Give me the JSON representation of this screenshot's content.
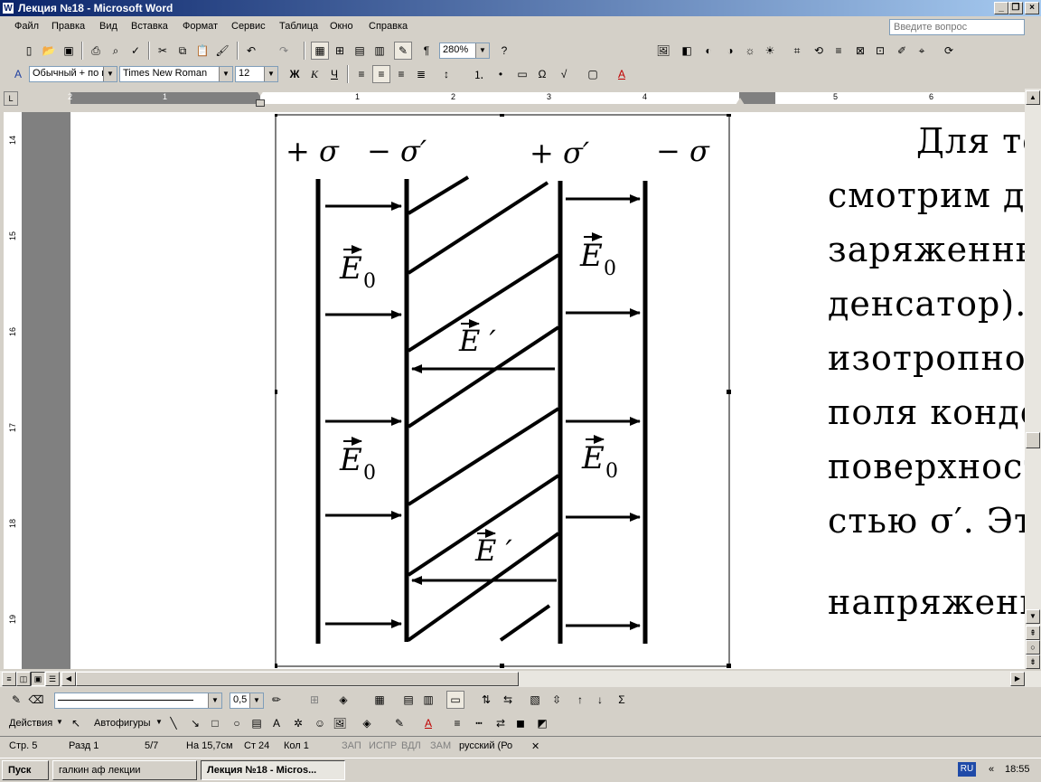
{
  "window": {
    "title": "Лекция №18 - Microsoft Word",
    "icon": "W"
  },
  "menu": {
    "items": [
      "Файл",
      "Правка",
      "Вид",
      "Вставка",
      "Формат",
      "Сервис",
      "Таблица",
      "Окно",
      "Справка"
    ],
    "help_placeholder": "Введите вопрос"
  },
  "standard_toolbar": {
    "zoom": "280%"
  },
  "format_toolbar": {
    "style": "Обычный + по ц",
    "font": "Times New Roman",
    "size": "12",
    "bold": "Ж",
    "italic": "К",
    "underline": "Ч"
  },
  "ruler": {
    "h_marks": [
      "2",
      "1",
      "1",
      "2",
      "3",
      "4",
      "5",
      "6",
      "7"
    ],
    "v_marks": [
      "14",
      "15",
      "16",
      "17",
      "18",
      "19"
    ]
  },
  "figure": {
    "labels": {
      "plus_sigma": "+ σ",
      "minus_sigma_prime": "− σ′",
      "plus_sigma_prime": "+ σ′",
      "minus_sigma": "− σ",
      "e0": "E",
      "e0_sub": "0",
      "eprime": "E ′"
    }
  },
  "document_text": {
    "lines": [
      "Для того",
      "смотрим две",
      "заряженные",
      "денсатор). Н",
      "изотропного",
      "поля конден",
      "поверхности",
      "стью σ′. Эт",
      "напряженно"
    ]
  },
  "drawing_toolbar": {
    "line_width": "0,5",
    "actions": "Действия",
    "autoshapes": "Автофигуры",
    "sigma": "Σ"
  },
  "status_bar": {
    "page": "Стр. 5",
    "section": "Разд 1",
    "pages": "5/7",
    "at": "На 15,7см",
    "line": "Ст 24",
    "col": "Кол 1",
    "rec": "ЗАП",
    "trk": "ИСПР",
    "ext": "ВДЛ",
    "ovr": "ЗАМ",
    "lang": "русский (Ро"
  },
  "taskbar": {
    "start": "Пуск",
    "tasks": [
      "галкин аф лекции",
      "Лекция №18 - Micros..."
    ],
    "lang": "RU",
    "time": "18:55"
  }
}
